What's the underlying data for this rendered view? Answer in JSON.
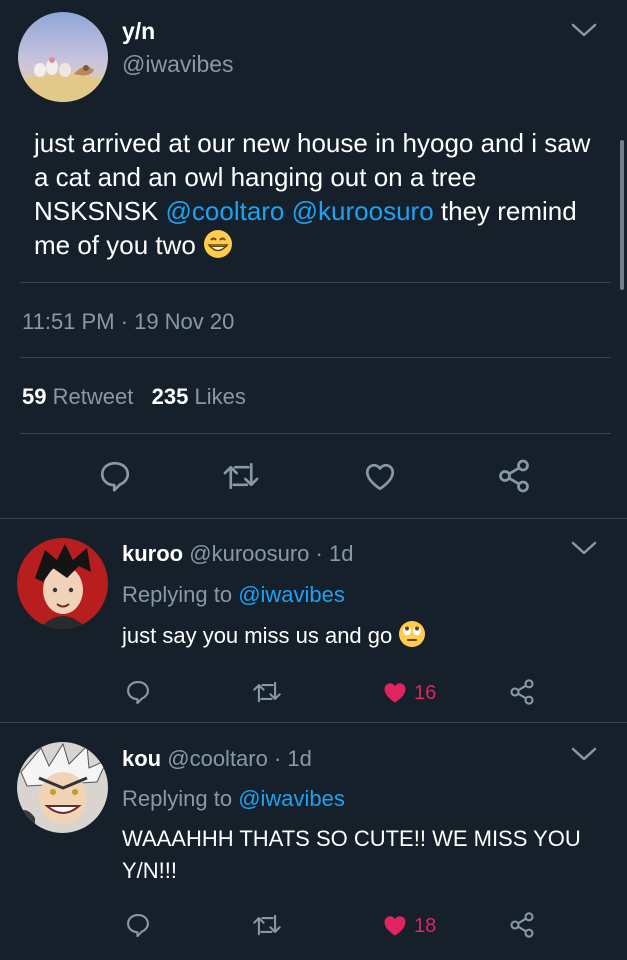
{
  "main_tweet": {
    "display_name": "y/n",
    "handle": "@iwavibes",
    "text_part1": "just arrived at our new house in hyogo and i saw a cat and an owl hanging out on a tree NSKSNSK ",
    "mention1": "@cooltaro",
    "mention2": "@kuroosuro",
    "text_part2": " they remind me of you two",
    "timestamp": "11:51 PM · 19 Nov 20",
    "retweet_count": "59",
    "retweet_label": "Retweet",
    "like_count": "235",
    "like_label": "Likes"
  },
  "replies": [
    {
      "display_name": "kuroo",
      "handle_time": "@kuroosuro · 1d",
      "replying_prefix": "Replying to",
      "replying_to": "@iwavibes",
      "text": "just say you miss us and go",
      "like_count": "16"
    },
    {
      "display_name": "kou",
      "handle_time": "@cooltaro · 1d",
      "replying_prefix": "Replying to",
      "replying_to": "@iwavibes",
      "text": "WAAAHHH THATS SO CUTE!! WE MISS YOU Y/N!!!",
      "like_count": "18"
    }
  ],
  "icons": [
    "chevron-down-icon",
    "reply-icon",
    "retweet-icon",
    "like-icon",
    "share-icon",
    "grin-emoji",
    "eye-roll-emoji"
  ],
  "colors": {
    "background": "#15202b",
    "accent": "#1da1f2",
    "muted": "#8899a6",
    "like_red": "#e0245e",
    "divider": "#38444d"
  }
}
